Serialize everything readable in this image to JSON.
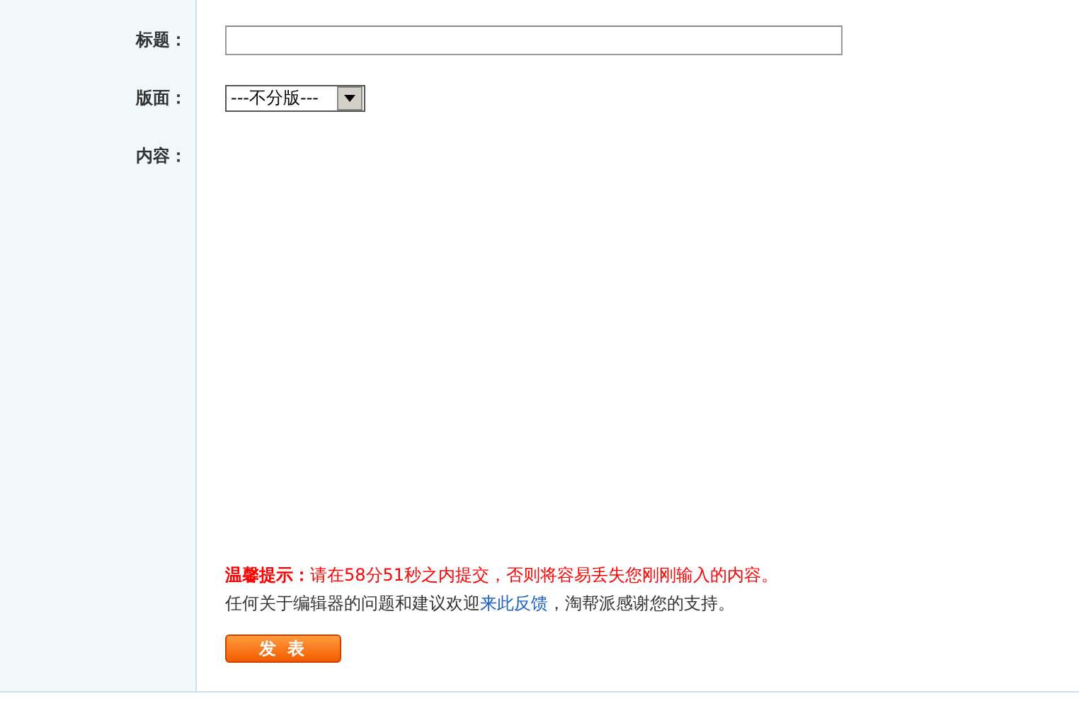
{
  "form": {
    "fields": [
      {
        "kind": "text",
        "label": "标题："
      },
      {
        "kind": "select",
        "label": "版面：",
        "value": "---不分版---"
      },
      {
        "kind": "editor",
        "label": "内容："
      }
    ]
  },
  "notice": {
    "warning": "**温馨提示：**请在58分51秒之内提交，否则将容易丢失您刚刚输入的内容。",
    "feedback_before": "任何关于编辑器的问题和建议欢迎",
    "feedback_link": "来此反馈",
    "feedback_after": "，淘帮派感谢您的支持。"
  },
  "submit_button": "发 表"
}
